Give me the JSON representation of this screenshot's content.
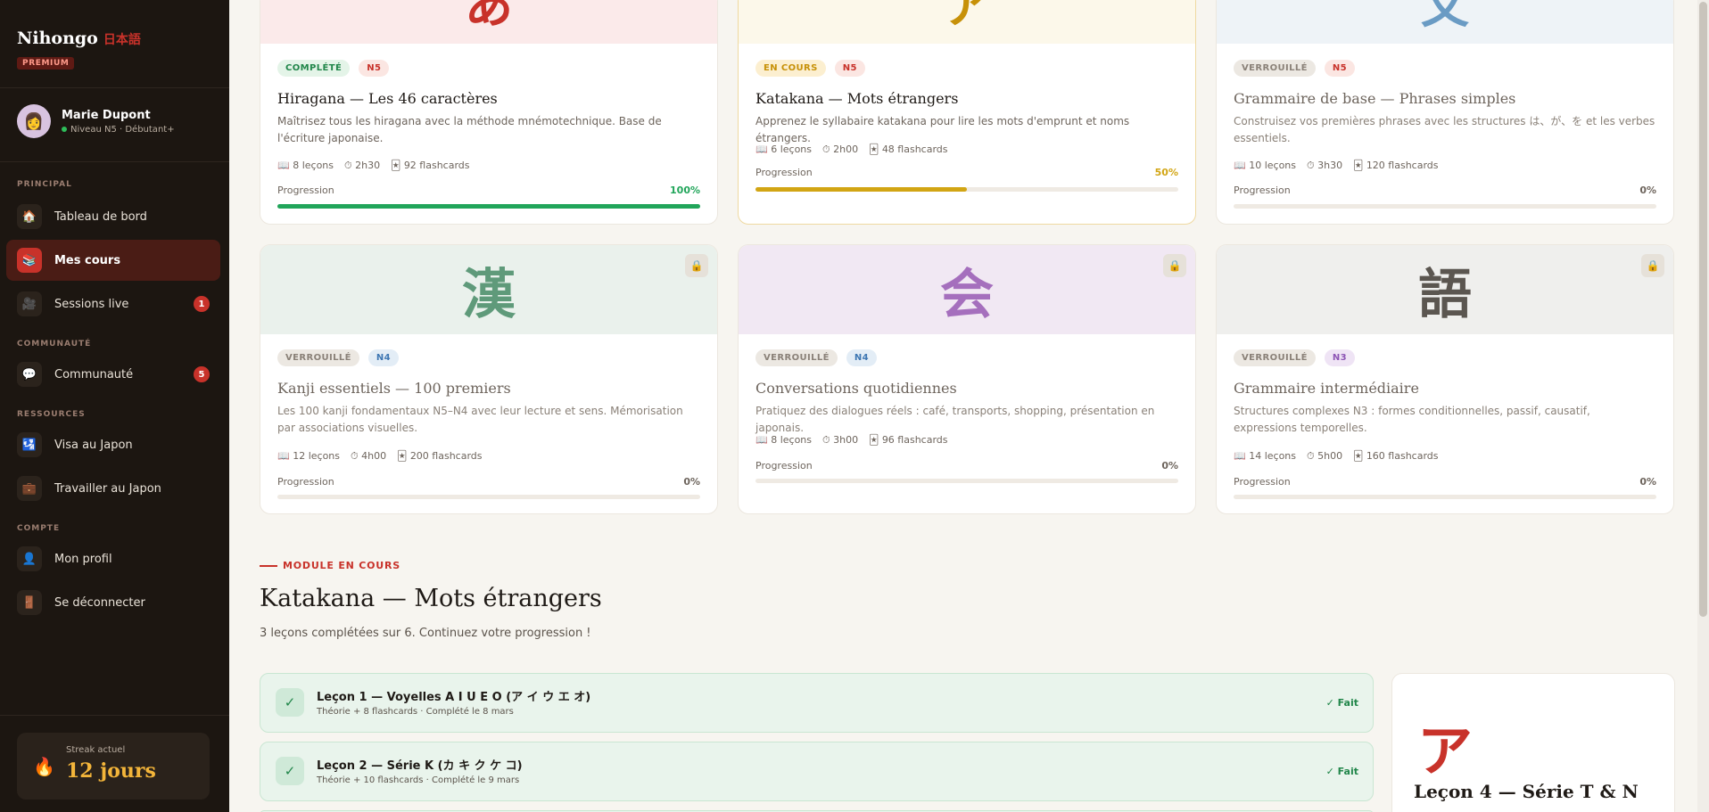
{
  "sidebar": {
    "brand": "Nihongo",
    "brand_jp": "日本語",
    "premium": "PREMIUM",
    "user": {
      "avatar": "👩",
      "name": "Marie Dupont",
      "level": "Niveau N5 · Débutant+"
    },
    "sections": {
      "principal": "PRINCIPAL",
      "communaute": "COMMUNAUTÉ",
      "ressources": "RESSOURCES",
      "compte": "COMPTE"
    },
    "items": [
      {
        "label": "Tableau de bord",
        "icon": "🏠"
      },
      {
        "label": "Mes cours",
        "icon": "📚"
      },
      {
        "label": "Sessions live",
        "icon": "🎥",
        "badge": "1"
      },
      {
        "label": "Communauté",
        "icon": "💬",
        "badge": "5"
      },
      {
        "label": "Visa au Japon",
        "icon": "🛂"
      },
      {
        "label": "Travailler au Japon",
        "icon": "💼"
      },
      {
        "label": "Mon profil",
        "icon": "👤"
      },
      {
        "label": "Se déconnecter",
        "icon": "🚪"
      }
    ],
    "streak": {
      "label": "Streak actuel",
      "value": "12 jours",
      "icon": "🔥"
    }
  },
  "courses": [
    {
      "char": "あ",
      "status": "COMPLÉTÉ",
      "level": "N5",
      "title": "Hiragana — Les 46 caractères",
      "desc": "Maîtrisez tous les hiragana avec la méthode mnémotechnique. Base de l'écriture japonaise.",
      "lessons": "8 leçons",
      "duration": "2h30",
      "cards": "92 flashcards",
      "progress_label": "Progression",
      "progress": "100%",
      "progress_value": 1.0,
      "color": "#21a55a"
    },
    {
      "char": "ア",
      "status": "EN COURS",
      "level": "N5",
      "title": "Katakana — Mots étrangers",
      "desc": "Apprenez le syllabaire katakana pour lire les mots d'emprunt et noms étrangers.",
      "lessons": "6 leçons",
      "duration": "2h00",
      "cards": "48 flashcards",
      "progress_label": "Progression",
      "progress": "50%",
      "progress_value": 0.5,
      "color": "#d2a514"
    },
    {
      "char": "文",
      "status": "VERROUILLÉ",
      "level": "N5",
      "title": "Grammaire de base — Phrases simples",
      "desc": "Construisez vos premières phrases avec les structures は、が、を et les verbes essentiels.",
      "lessons": "10 leçons",
      "duration": "3h30",
      "cards": "120 flashcards",
      "progress_label": "Progression",
      "progress": "0%",
      "progress_value": 0.0,
      "color": "#c9c4bc"
    },
    {
      "char": "漢",
      "status": "VERROUILLÉ",
      "level": "N4",
      "title": "Kanji essentiels — 100 premiers",
      "desc": "Les 100 kanji fondamentaux N5–N4 avec leur lecture et sens. Mémorisation par associations visuelles.",
      "lessons": "12 leçons",
      "duration": "4h00",
      "cards": "200 flashcards",
      "progress_label": "Progression",
      "progress": "0%",
      "progress_value": 0.0,
      "color": "#c9c4bc"
    },
    {
      "char": "会",
      "status": "VERROUILLÉ",
      "level": "N4",
      "title": "Conversations quotidiennes",
      "desc": "Pratiquez des dialogues réels : café, transports, shopping, présentation en japonais.",
      "lessons": "8 leçons",
      "duration": "3h00",
      "cards": "96 flashcards",
      "progress_label": "Progression",
      "progress": "0%",
      "progress_value": 0.0,
      "color": "#c9c4bc"
    },
    {
      "char": "語",
      "status": "VERROUILLÉ",
      "level": "N3",
      "title": "Grammaire intermédiaire",
      "desc": "Structures complexes N3 : formes conditionnelles, passif, causatif, expressions temporelles.",
      "lessons": "14 leçons",
      "duration": "5h00",
      "cards": "160 flashcards",
      "progress_label": "Progression",
      "progress": "0%",
      "progress_value": 0.0,
      "color": "#c9c4bc"
    }
  ],
  "module": {
    "kicker": "MODULE EN COURS",
    "title": "Katakana — Mots étrangers",
    "subtitle": "3 leçons complétées sur 6. Continuez votre progression !",
    "lessons": [
      {
        "title": "Leçon 1 — Voyelles A I U E O (ア イ ウ エ オ)",
        "sub": "Théorie + 8 flashcards · Complété le 8 mars",
        "status": "✓ Fait"
      },
      {
        "title": "Leçon 2 — Série K (カ キ ク ケ コ)",
        "sub": "Théorie + 10 flashcards · Complété le 9 mars",
        "status": "✓ Fait"
      }
    ],
    "next": {
      "char": "ア",
      "title": "Leçon 4 — Série T & N"
    }
  }
}
